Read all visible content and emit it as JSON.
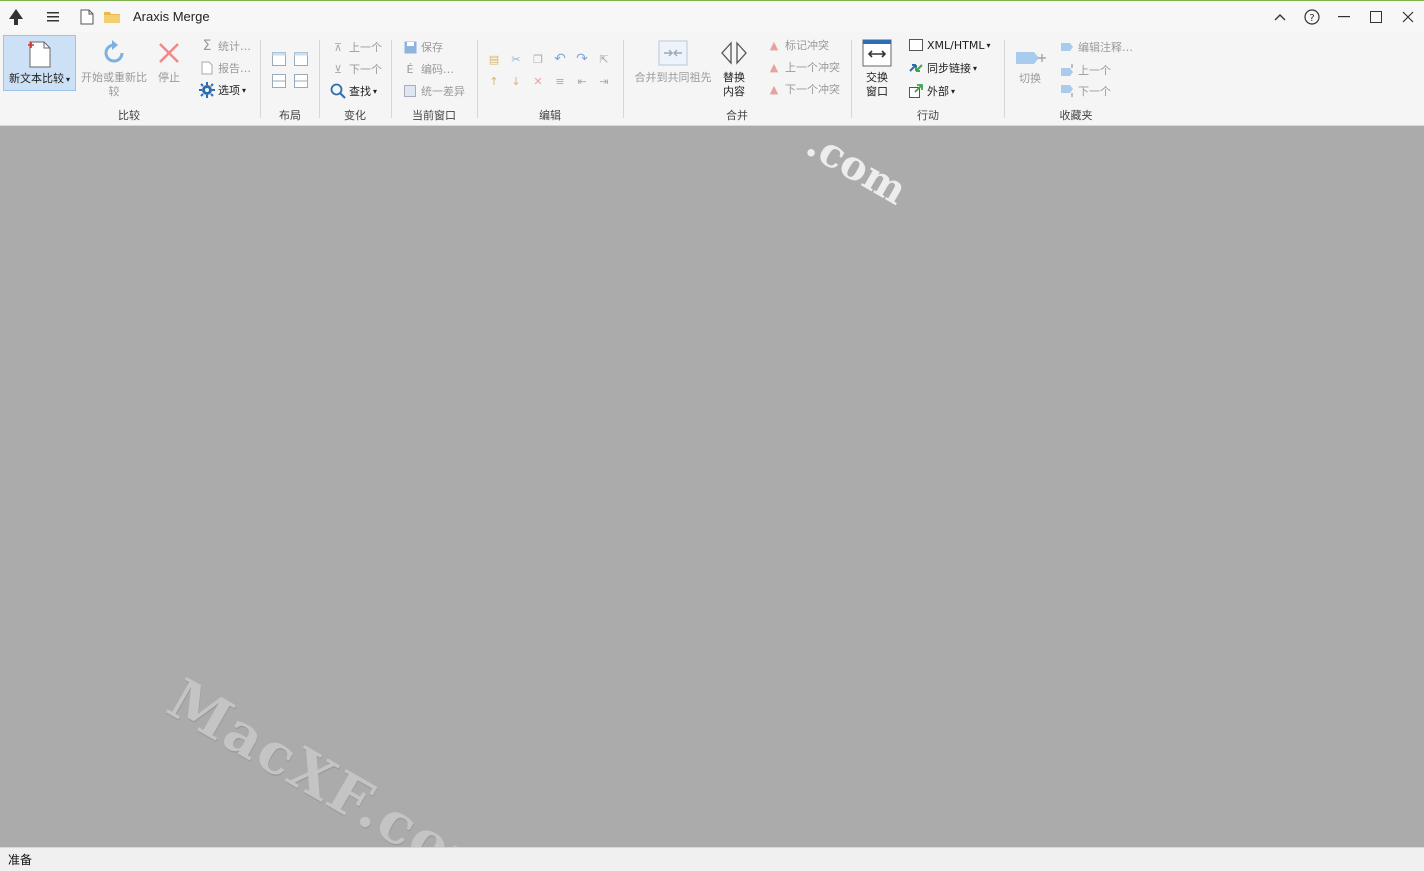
{
  "titlebar": {
    "app_title": "Araxis Merge"
  },
  "watermarks": {
    "main": "MacXF.com",
    "top": ".com"
  },
  "ribbon": {
    "compare": {
      "label": "比较",
      "new_text_compare": "新文本比较",
      "start_recompare": "开始或重新比较",
      "stop": "停止",
      "stats": "统计…",
      "report": "报告…",
      "options": "选项"
    },
    "layout": {
      "label": "布局"
    },
    "changes": {
      "label": "变化",
      "prev": "上一个",
      "next": "下一个",
      "find": "查找"
    },
    "current_window": {
      "label": "当前窗口",
      "save": "保存",
      "encoding": "编码…",
      "unify": "统一差异"
    },
    "edit": {
      "label": "编辑"
    },
    "merge": {
      "label": "合并",
      "merge_common": "合并到共同祖先",
      "replace_content": "替换内容",
      "mark_conflict": "标记冲突",
      "prev_conflict": "上一个冲突",
      "next_conflict": "下一个冲突"
    },
    "actions": {
      "label": "行动",
      "swap_window": "交换窗口",
      "xml_html": "XML/HTML",
      "sync_link": "同步链接",
      "external": "外部"
    },
    "bookmarks": {
      "label": "收藏夹",
      "toggle": "切换",
      "edit_note": "编辑注释…",
      "prev": "上一个",
      "next": "下一个"
    }
  },
  "status": {
    "text": "准备"
  },
  "colors": {
    "accent": "#7fb24a",
    "selected_bg": "#cde1f6",
    "work_bg": "#ababab"
  }
}
